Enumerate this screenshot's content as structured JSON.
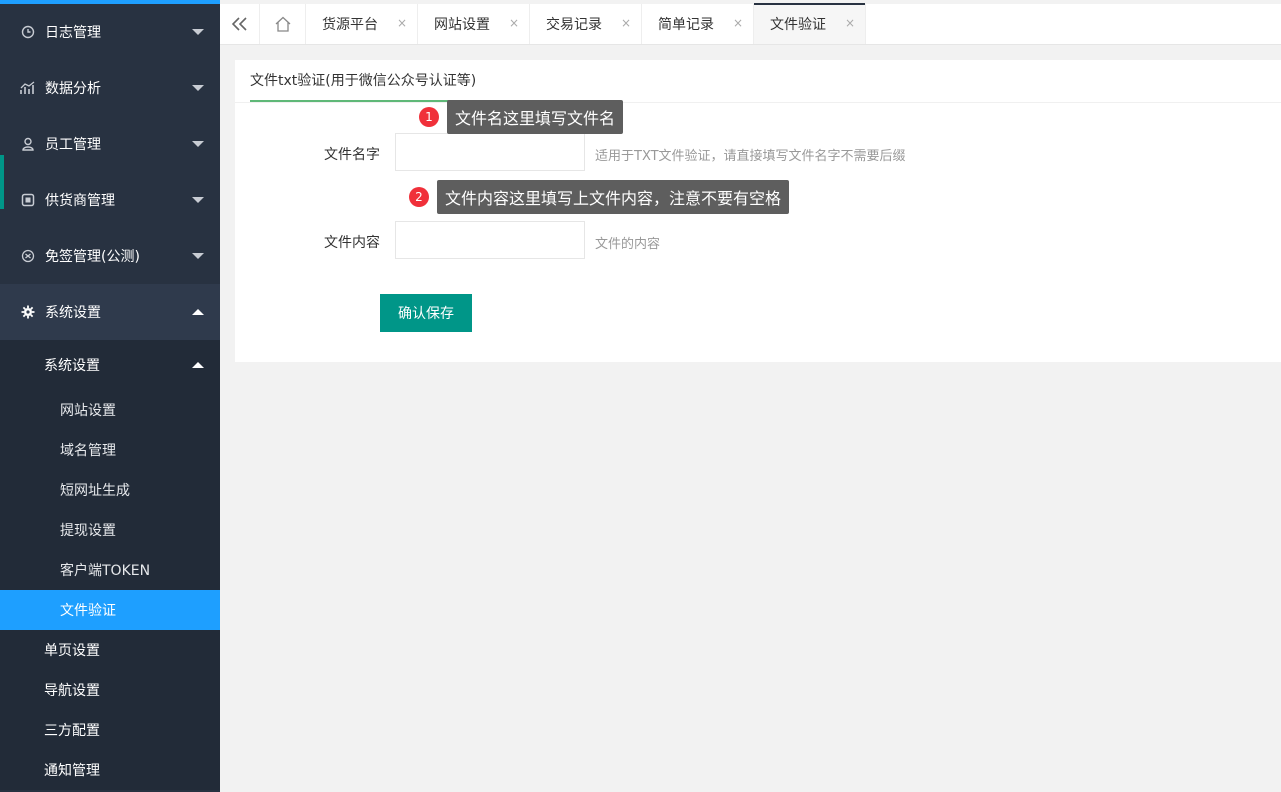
{
  "sidebar": {
    "menu": [
      {
        "label": "日志管理",
        "icon": "clock-icon"
      },
      {
        "label": "数据分析",
        "icon": "chart-icon"
      },
      {
        "label": "员工管理",
        "icon": "user-icon"
      },
      {
        "label": "供货商管理",
        "icon": "supplier-icon"
      },
      {
        "label": "免签管理(公测)",
        "icon": "badge-icon"
      },
      {
        "label": "系统设置",
        "icon": "gear-icon"
      }
    ],
    "sub_head": "系统设置",
    "sub_items": [
      "网站设置",
      "域名管理",
      "短网址生成",
      "提现设置",
      "客户端TOKEN",
      "文件验证"
    ],
    "level2": [
      "单页设置",
      "导航设置",
      "三方配置",
      "通知管理"
    ]
  },
  "tabs": {
    "items": [
      "货源平台",
      "网站设置",
      "交易记录",
      "简单记录",
      "文件验证"
    ],
    "close": "×"
  },
  "card": {
    "tab_title": "文件txt验证(用于微信公众号认证等)",
    "name_label": "文件名字",
    "name_value": "",
    "name_aux": "适用于TXT文件验证，请直接填写文件名字不需要后缀",
    "content_label": "文件内容",
    "content_value": "",
    "content_aux": "文件的内容",
    "save_label": "确认保存"
  },
  "annotations": [
    {
      "num": "1",
      "text": "文件名这里填写文件名"
    },
    {
      "num": "2",
      "text": "文件内容这里填写上文件内容，注意不要有空格"
    }
  ],
  "colors": {
    "sidebar_bg": "#283241",
    "active_blue": "#1E9FFF",
    "primary_green": "#009688",
    "tab_underline": "#5FB878"
  }
}
